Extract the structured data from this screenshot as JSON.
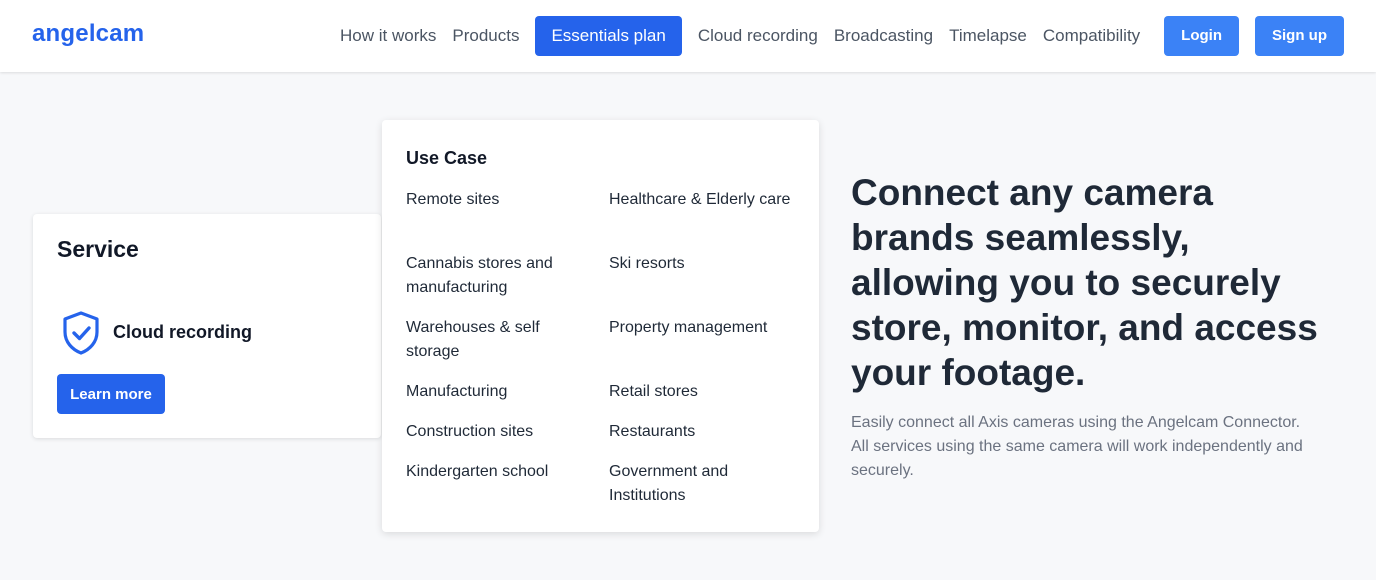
{
  "brand": {
    "logo": "angelcam",
    "accent": "#2563eb"
  },
  "nav": {
    "links": [
      "How it works",
      "Products",
      "Essentials plan",
      "Cloud recording",
      "Broadcasting",
      "Timelapse",
      "Compatibility"
    ],
    "active": "Essentials plan",
    "login": "Login",
    "signup": "Sign up"
  },
  "service": {
    "title": "Service",
    "icon": "shield-check-icon",
    "name": "Cloud recording",
    "button": "Learn more"
  },
  "use_case": {
    "title": "Use Case",
    "items": [
      "Remote sites",
      "Healthcare & Elderly care",
      "Cannabis stores and manufacturing",
      "Ski resorts",
      "Warehouses & self storage",
      "Property management",
      "Manufacturing",
      "Retail stores",
      "Construction sites",
      "Restaurants",
      "Kindergarten school",
      "Government and Institutions"
    ]
  },
  "hero": {
    "heading": "Connect any camera brands seamlessly, allowing you to securely store, monitor, and access your footage.",
    "subtext": "Easily connect all Axis cameras using the Angelcam Connector. All services using the same camera will work independently and securely."
  }
}
